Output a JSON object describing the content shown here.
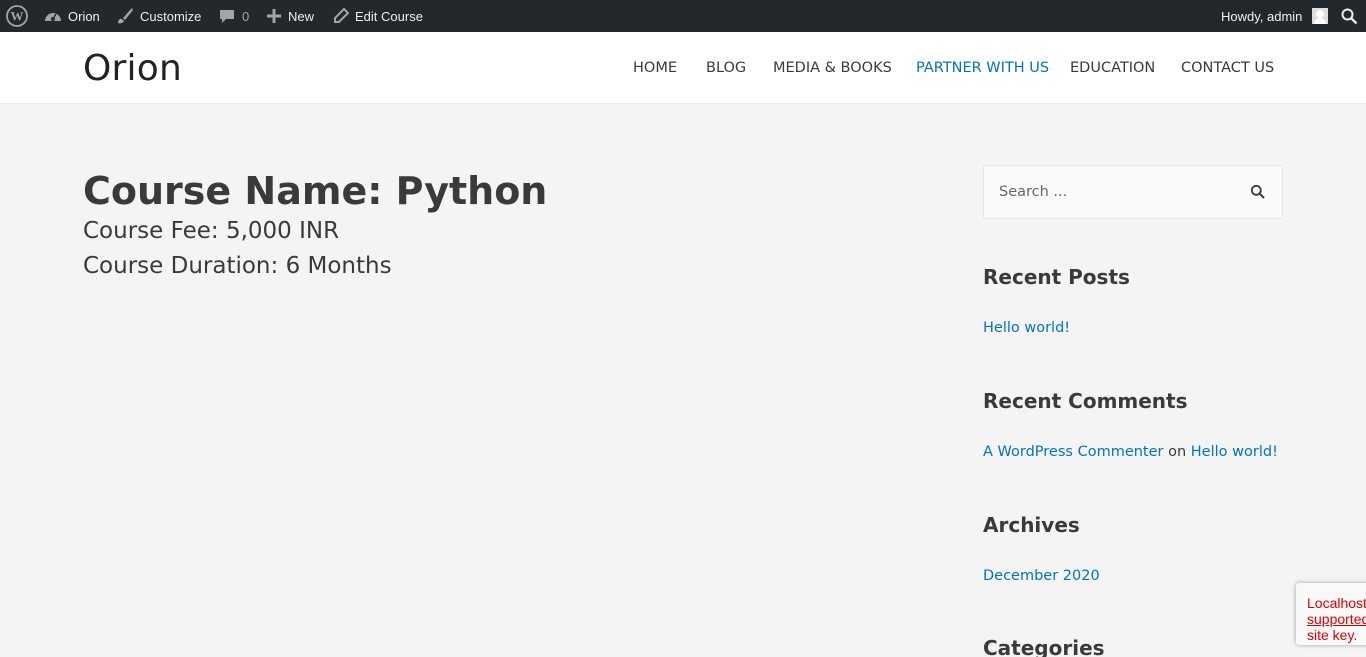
{
  "adminbar": {
    "wp_icon": "wordpress-icon",
    "site_name": "Orion",
    "customize_label": "Customize",
    "comments_count": "0",
    "new_label": "New",
    "edit_label": "Edit Course",
    "howdy_label": "Howdy, admin",
    "search_icon": "search-icon"
  },
  "header": {
    "site_title": "Orion",
    "nav": [
      {
        "label": "HOME"
      },
      {
        "label": "BLOG"
      },
      {
        "label": "MEDIA & BOOKS"
      },
      {
        "label": "PARTNER WITH US"
      },
      {
        "label": "EDUCATION"
      },
      {
        "label": "CONTACT US"
      }
    ]
  },
  "main": {
    "course_name": "Course Name: Python",
    "course_fee": "Course Fee: 5,000 INR",
    "course_duration": "Course Duration: 6 Months"
  },
  "sidebar": {
    "search_placeholder": "Search ...",
    "recent_posts_title": "Recent Posts",
    "recent_post_1": "Hello world!",
    "recent_comments_title": "Recent Comments",
    "comment_author": "A WordPress Commenter",
    "comment_on": "on",
    "comment_post": "Hello world!",
    "archives_title": "Archives",
    "archive_1": "December 2020",
    "categories_title": "Categories"
  },
  "recaptcha": {
    "line1": "Localhost",
    "line2": "supported",
    "line3": "site key."
  },
  "colors": {
    "link": "#0274be",
    "adminbar_bg": "#23282d",
    "page_bg": "#f4f4f4",
    "error_red": "#d00"
  }
}
